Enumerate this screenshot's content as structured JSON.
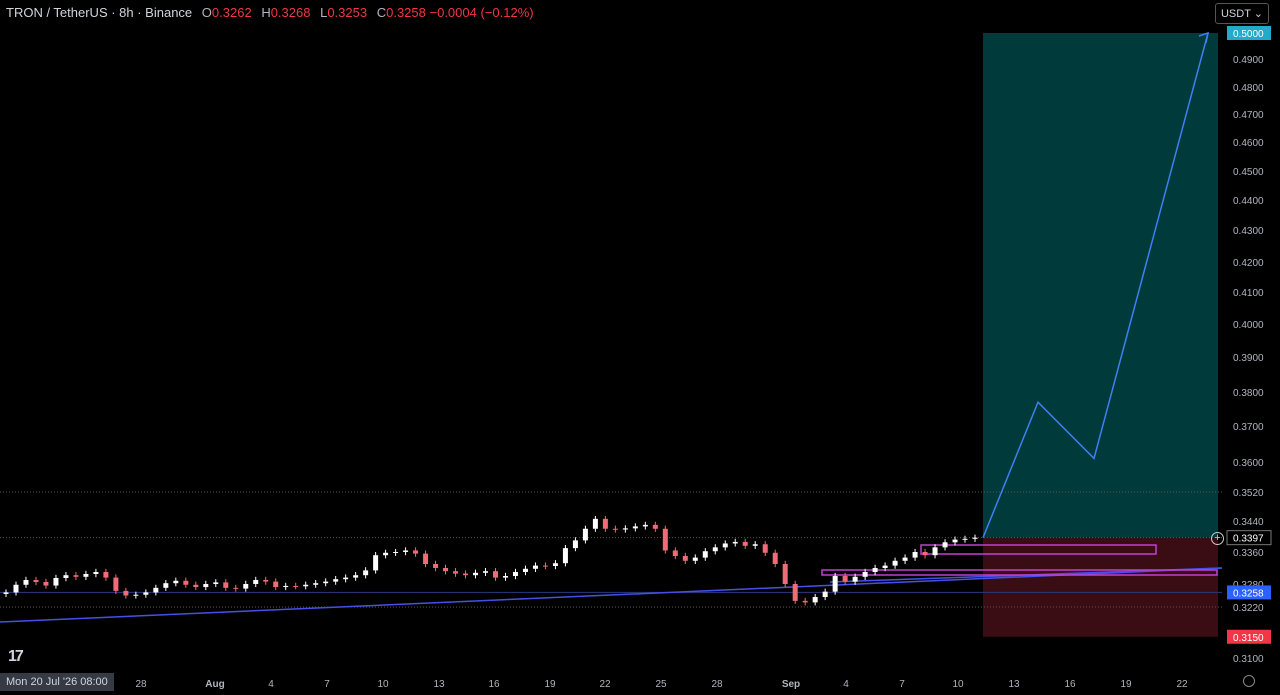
{
  "header": {
    "symbol": "TRON / TetherUS · 8h · Binance",
    "o_label": "O",
    "o": "0.3262",
    "h_label": "H",
    "h": "0.3268",
    "l_label": "L",
    "l": "0.3253",
    "c_label": "C",
    "c": "0.3258",
    "change": "−0.0004 (−0.12%)"
  },
  "currency_button": "USDT ⌄",
  "cursor_date": "Mon 20 Jul '26  08:00",
  "logo": "17",
  "colors": {
    "up": "#ffffff",
    "down": "#f26a78",
    "target": "#003a3a",
    "stop": "#3a0d14",
    "arrow": "#3d7ff5",
    "trend": "#4650e8",
    "zone": "#c040d0",
    "price_tag": "#2962ff",
    "target_tag": "#22aacc",
    "stop_tag": "#f23645"
  },
  "chart_data": {
    "type": "candlestick",
    "x_tick_labels": [
      "28",
      "Aug",
      "4",
      "7",
      "10",
      "13",
      "16",
      "19",
      "22",
      "25",
      "28",
      "Sep",
      "4",
      "7",
      "10",
      "13",
      "16",
      "19",
      "22"
    ],
    "y_tick_labels": [
      "0.4900",
      "0.4800",
      "0.4700",
      "0.4600",
      "0.4500",
      "0.4400",
      "0.4300",
      "0.4200",
      "0.4100",
      "0.4000",
      "0.3900",
      "0.3800",
      "0.3700",
      "0.3600",
      "0.3520",
      "0.3440",
      "0.3360",
      "0.3280",
      "0.3220",
      "0.3100"
    ],
    "price_tags": [
      {
        "label": "0.5000",
        "role": "target",
        "value": 0.5
      },
      {
        "label": "0.3397",
        "role": "current",
        "value": 0.3397
      },
      {
        "label": "0.3258",
        "role": "last",
        "value": 0.3258
      },
      {
        "label": "0.3150",
        "role": "stop",
        "value": 0.315
      }
    ],
    "series": [
      {
        "key": "close",
        "values": [
          0.3258,
          0.3278,
          0.329,
          0.3285,
          0.3276,
          0.3295,
          0.3302,
          0.3298,
          0.3305,
          0.331,
          0.3296,
          0.3262,
          0.325,
          0.3252,
          0.3258,
          0.327,
          0.3282,
          0.3288,
          0.3278,
          0.3272,
          0.328,
          0.3284,
          0.327,
          0.3268,
          0.328,
          0.329,
          0.3286,
          0.3272,
          0.3275,
          0.3274,
          0.3278,
          0.3282,
          0.3286,
          0.3292,
          0.3296,
          0.3302,
          0.3314,
          0.3352,
          0.3358,
          0.336,
          0.3364,
          0.3356,
          0.333,
          0.332,
          0.3312,
          0.3306,
          0.3302,
          0.3308,
          0.3312,
          0.3296,
          0.33,
          0.331,
          0.3318,
          0.3326,
          0.3325,
          0.3332,
          0.337,
          0.339,
          0.342,
          0.3446,
          0.342,
          0.3418,
          0.3421,
          0.3426,
          0.343,
          0.342,
          0.3364,
          0.335,
          0.3338,
          0.3346,
          0.3362,
          0.3372,
          0.3382,
          0.3386,
          0.3376,
          0.338,
          0.3358,
          0.333,
          0.328,
          0.3236,
          0.3232,
          0.3246,
          0.326,
          0.33,
          0.3286,
          0.3298,
          0.331,
          0.332,
          0.3326,
          0.3338,
          0.3346,
          0.336,
          0.3352,
          0.3372,
          0.3385,
          0.3392,
          0.3394,
          0.3397
        ]
      }
    ],
    "levels": {
      "target": 0.5,
      "entry": 0.3397,
      "stop": 0.315
    },
    "projection": [
      {
        "label": "start",
        "value": 0.3397
      },
      {
        "label": "peak1",
        "value": 0.377
      },
      {
        "label": "pullback",
        "value": 0.361
      },
      {
        "label": "target",
        "value": 0.5
      }
    ]
  }
}
